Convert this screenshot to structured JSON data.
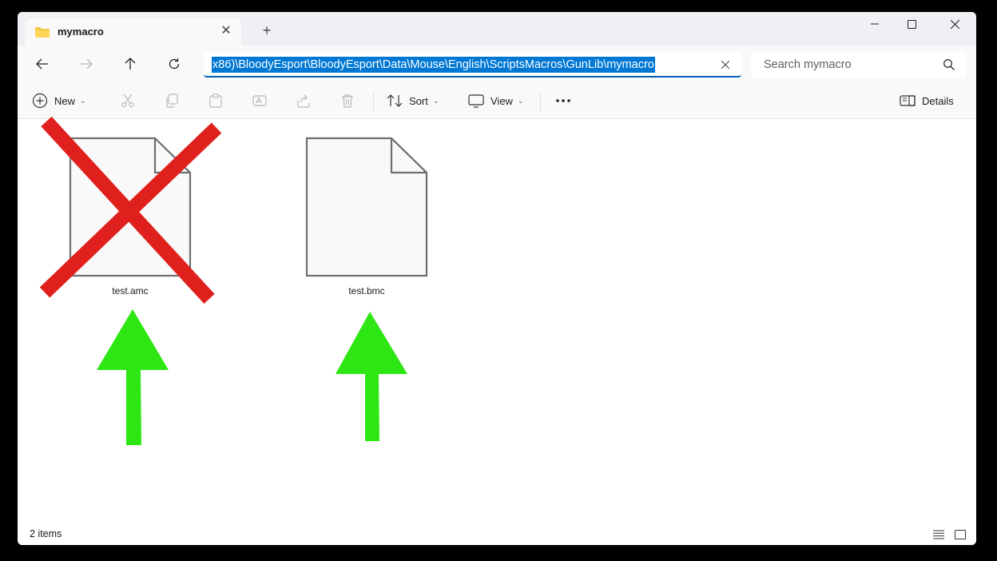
{
  "tab": {
    "title": "mymacro",
    "icon": "folder-icon"
  },
  "window_controls": [
    "minimize-icon",
    "maximize-icon",
    "close-icon"
  ],
  "nav": {
    "icons": [
      "back-arrow-icon",
      "forward-arrow-icon",
      "up-arrow-icon",
      "refresh-icon"
    ]
  },
  "address": {
    "path": "x86)\\BloodyEsport\\BloodyEsport\\Data\\Mouse\\English\\ScriptsMacros\\GunLib\\mymacro"
  },
  "search": {
    "placeholder": "Search mymacro"
  },
  "toolbar": {
    "new_label": "New",
    "sort_label": "Sort",
    "view_label": "View",
    "details_label": "Details"
  },
  "files": [
    {
      "name": "test.amc",
      "annotation": "red-x-mark"
    },
    {
      "name": "test.bmc",
      "annotation": "none"
    }
  ],
  "status": {
    "item_count": "2 items"
  },
  "colors": {
    "accent": "#0078d4",
    "annotation_red": "#e0201c",
    "annotation_green": "#2ee614",
    "folder_yellow": "#f2c744"
  }
}
